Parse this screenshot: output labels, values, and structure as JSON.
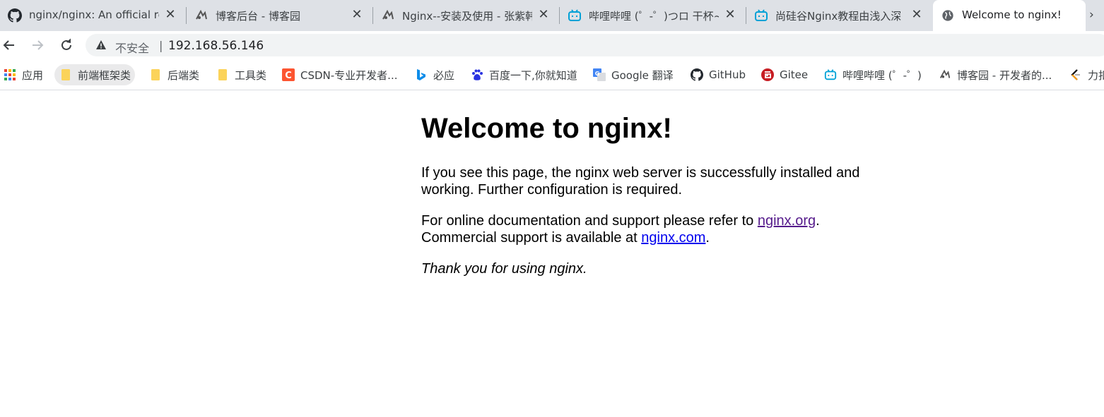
{
  "tabs": [
    {
      "title": "nginx/nginx: An official re",
      "icon": "github-icon"
    },
    {
      "title": "博客后台 - 博客园",
      "icon": "cnblogs-icon"
    },
    {
      "title": "Nginx--安装及使用 - 张紫韩",
      "icon": "cnblogs-icon"
    },
    {
      "title": "哔哩哔哩 (゜-゜)つロ 干杯~",
      "icon": "bilibili-icon"
    },
    {
      "title": "尚硅谷Nginx教程由浅入深",
      "icon": "bilibili-icon"
    },
    {
      "title": "Welcome to nginx!",
      "icon": "globe-icon",
      "active": true
    }
  ],
  "toolbar": {
    "security_label": "不安全",
    "divider": "|",
    "url": "192.168.56.146"
  },
  "bookmarks": [
    {
      "label": "应用",
      "icon": "apps-grid-icon"
    },
    {
      "label": "前端框架类",
      "icon": "folder-icon"
    },
    {
      "label": "后端类",
      "icon": "folder-icon"
    },
    {
      "label": "工具类",
      "icon": "folder-icon"
    },
    {
      "label": "CSDN-专业开发者...",
      "icon": "csdn-icon"
    },
    {
      "label": "必应",
      "icon": "bing-icon"
    },
    {
      "label": "百度一下,你就知道",
      "icon": "baidu-icon"
    },
    {
      "label": "Google 翻译",
      "icon": "google-translate-icon"
    },
    {
      "label": "GitHub",
      "icon": "github-icon"
    },
    {
      "label": "Gitee",
      "icon": "gitee-icon"
    },
    {
      "label": "哔哩哔哩 (゜-゜)",
      "icon": "bilibili-icon"
    },
    {
      "label": "博客园 - 开发者的...",
      "icon": "cnblogs-icon"
    },
    {
      "label": "力扣",
      "icon": "leetcode-icon"
    }
  ],
  "page": {
    "heading": "Welcome to nginx!",
    "para1": "If you see this page, the nginx web server is successfully installed and working. Further configuration is required.",
    "para2_before": "For online documentation and support please refer to ",
    "para2_link1": "nginx.org",
    "para2_mid": ".",
    "para2_line2": "Commercial support is available at ",
    "para2_link2": "nginx.com",
    "para2_end": ".",
    "para3": "Thank you for using nginx."
  },
  "colors": {
    "tabstrip": "#dee1e6",
    "visited_link": "#551a8b",
    "link": "#0000ee",
    "bilibili": "#00a1d6",
    "folder": "#fbd35a"
  }
}
